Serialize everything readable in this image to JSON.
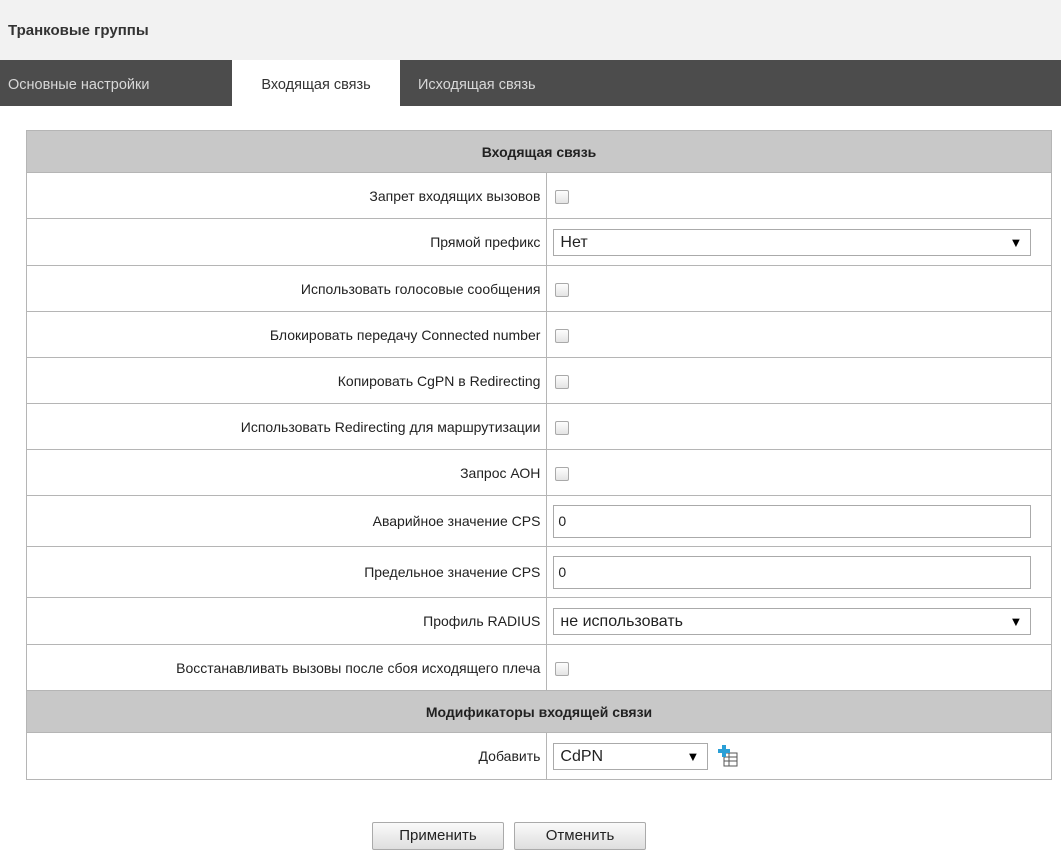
{
  "page": {
    "title": "Транковые группы"
  },
  "tabs": [
    {
      "label": "Основные настройки",
      "active": false
    },
    {
      "label": "Входящая связь",
      "active": true
    },
    {
      "label": "Исходящая связь",
      "active": false
    }
  ],
  "section_incoming": {
    "header": "Входящая связь",
    "fields": {
      "deny_incoming": {
        "label": "Запрет входящих вызовов",
        "checked": false
      },
      "direct_prefix": {
        "label": "Прямой префикс",
        "value": "Нет"
      },
      "use_voice_messages": {
        "label": "Использовать голосовые сообщения",
        "checked": false
      },
      "block_connected_number": {
        "label": "Блокировать передачу Connected number",
        "checked": false
      },
      "copy_cgpn_redirecting": {
        "label": "Копировать CgPN в Redirecting",
        "checked": false
      },
      "use_redirecting_routing": {
        "label": "Использовать Redirecting для маршрутизации",
        "checked": false
      },
      "aon_request": {
        "label": "Запрос АОН",
        "checked": false
      },
      "alarm_cps": {
        "label": "Аварийное значение CPS",
        "value": "0"
      },
      "limit_cps": {
        "label": "Предельное значение CPS",
        "value": "0"
      },
      "radius_profile": {
        "label": "Профиль RADIUS",
        "value": "не использовать"
      },
      "restore_calls": {
        "label": "Восстанавливать вызовы после сбоя исходящего плеча",
        "checked": false
      }
    }
  },
  "section_modifiers": {
    "header": "Модификаторы входящей связи",
    "add": {
      "label": "Добавить",
      "value": "CdPN",
      "icon": "add-modifier-icon"
    }
  },
  "buttons": {
    "apply": "Применить",
    "cancel": "Отменить"
  }
}
